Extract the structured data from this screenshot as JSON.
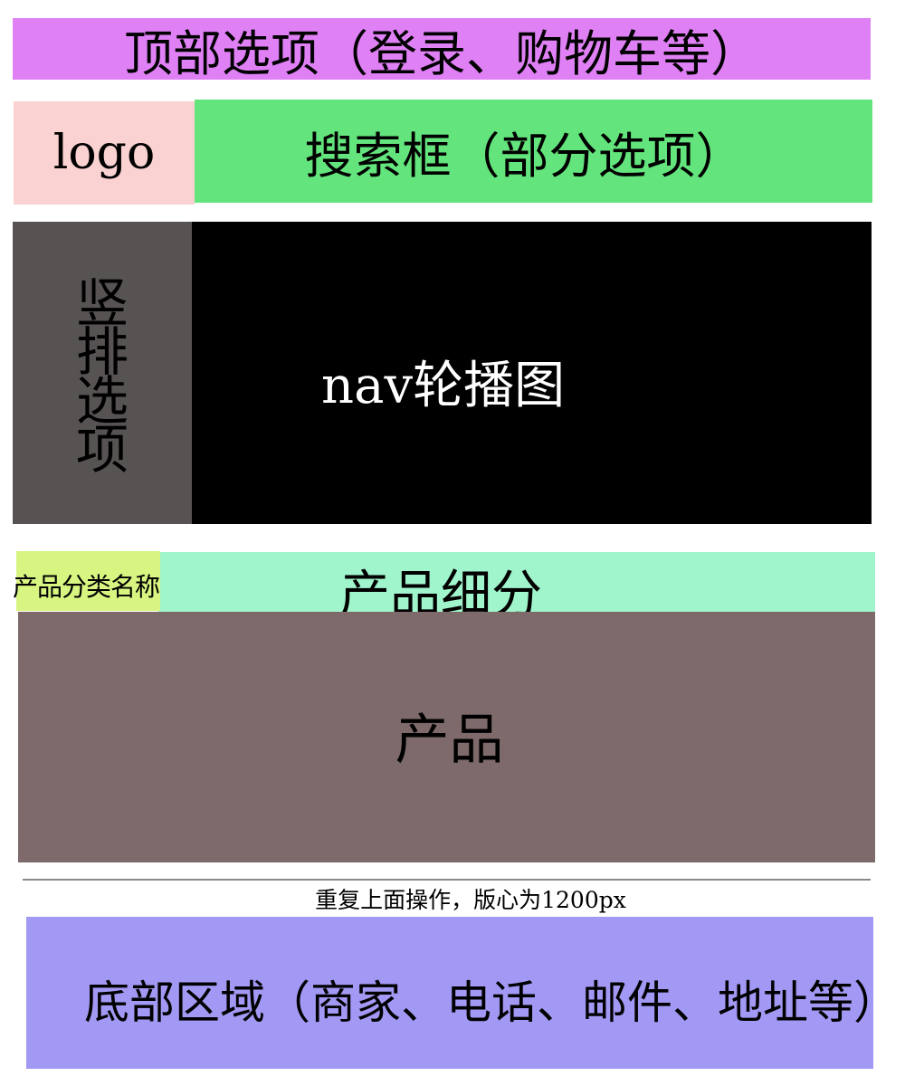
{
  "sections": {
    "top_bar": {
      "label": "顶部选项（登录、购物车等）",
      "color": "#df80f5"
    },
    "logo": {
      "label": "logo",
      "color": "#fad2d2"
    },
    "search": {
      "label": "搜索框（部分选项）",
      "color": "#63e47c"
    },
    "vertical_options": {
      "label": "竖排选项",
      "color": "#575353"
    },
    "carousel": {
      "label": "nav轮播图",
      "color": "#000000"
    },
    "category_name": {
      "label": "产品分类名称",
      "color": "#d8f582"
    },
    "subdivision": {
      "label": "产品细分",
      "color": "#a0f5cc"
    },
    "products": {
      "label": "产品",
      "color": "#7e6a6a"
    },
    "note": {
      "label": "重复上面操作，版心为1200px"
    },
    "footer": {
      "label": "底部区域（商家、电话、邮件、地址等）",
      "color": "#a299f4"
    }
  }
}
